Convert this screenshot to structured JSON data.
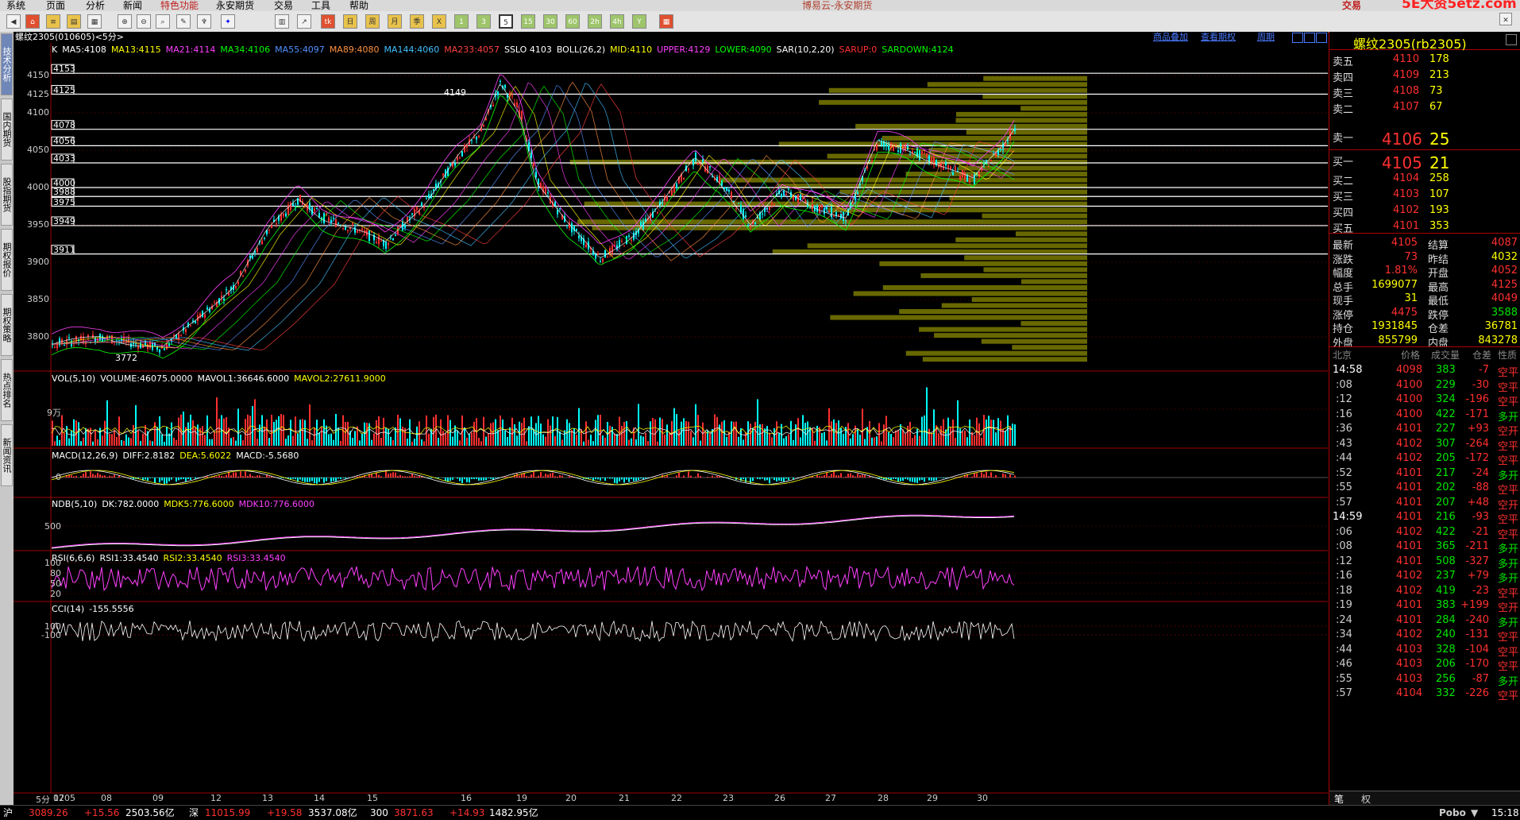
{
  "menu": {
    "items": [
      "系统",
      "页面",
      "分析",
      "新闻",
      "特色功能",
      "永安期货",
      "交易",
      "工具",
      "帮助"
    ],
    "title": "博易云-永安期货",
    "trade": "交易",
    "watermark": "5E大资5etz.com"
  },
  "sidetabs": [
    "技术分析",
    "国内期货",
    "股指期货",
    "期权报价",
    "期权策略",
    "热点排名",
    "新闻资讯"
  ],
  "toolbar": {
    "buttons": [
      "1",
      "3",
      "5",
      "15",
      "30",
      "60",
      "2h",
      "4h",
      "Y"
    ]
  },
  "chart": {
    "contract": "螺纹2305(010605)<5分>",
    "links": [
      "商品叠加",
      "查看期权",
      "周期"
    ],
    "price_ind": [
      {
        "t": "K",
        "c": "#ffffff"
      },
      {
        "t": "MA5:4108",
        "c": "#ffffff"
      },
      {
        "t": "MA13:4115",
        "c": "#ffff00"
      },
      {
        "t": "MA21:4114",
        "c": "#ff40ff"
      },
      {
        "t": "MA34:4106",
        "c": "#00ff00"
      },
      {
        "t": "MA55:4097",
        "c": "#5090ff"
      },
      {
        "t": "MA89:4080",
        "c": "#ff9040"
      },
      {
        "t": "MA144:4060",
        "c": "#40c0ff"
      },
      {
        "t": "MA233:4057",
        "c": "#ff4040"
      },
      {
        "t": "SSLO 4103",
        "c": "#ffffff"
      },
      {
        "t": "BOLL(26,2)",
        "c": "#ffffff"
      },
      {
        "t": "MID:4110",
        "c": "#ffff00"
      },
      {
        "t": "UPPER:4129",
        "c": "#ff40ff"
      },
      {
        "t": "LOWER:4090",
        "c": "#00ff00"
      },
      {
        "t": "SAR(10,2,20)",
        "c": "#ffffff"
      },
      {
        "t": "SARUP:0",
        "c": "#ff3030"
      },
      {
        "t": "SARDOWN:4124",
        "c": "#00ff00"
      }
    ],
    "y_labels": [
      "4150",
      "4125",
      "4100",
      "4050",
      "4000",
      "3950",
      "3900",
      "3850",
      "3800"
    ],
    "y_values": [
      4150,
      4125,
      4100,
      4050,
      4000,
      3950,
      3900,
      3850,
      3800
    ],
    "hlines": [
      4153,
      4125,
      4078,
      4056,
      4033,
      4000,
      3988,
      3975,
      3949,
      3911
    ],
    "hline_labels": [
      "4153",
      "4125",
      "4078",
      "4056",
      "4033",
      "4000",
      "3988",
      "3975",
      "3949",
      "3911"
    ],
    "high_mark": "4149",
    "low_mark": "3772",
    "vol": {
      "title": "VOL(5,10)",
      "v": "VOLUME:46075.0000",
      "m1": "MAVOL1:36646.6000",
      "m2": "MAVOL2:27611.9000",
      "axis": "9万"
    },
    "macd": {
      "title": "MACD(12,26,9)",
      "diff": "DIFF:2.8182",
      "dea": "DEA:5.6022",
      "macd": "MACD:-5.5680",
      "axis": "0"
    },
    "ndb": {
      "title": "NDB(5,10)",
      "dk": "DK:782.0000",
      "m5": "MDK5:776.6000",
      "m10": "MDK10:776.6000",
      "axis": "500"
    },
    "rsi": {
      "title": "RSI(6,6,6)",
      "r1": "RSI1:33.4540",
      "r2": "RSI2:33.4540",
      "r3": "RSI3:33.4540",
      "axis": [
        "100",
        "80",
        "50",
        "20"
      ]
    },
    "cci": {
      "title": "CCI(14)",
      "v": "-155.5556",
      "axis": [
        "100",
        "-100"
      ]
    },
    "x_labels": [
      "5分",
      "1205",
      "07",
      "08",
      "09",
      "12",
      "13",
      "14",
      "15",
      "16",
      "19",
      "20",
      "21",
      "22",
      "23",
      "26",
      "27",
      "28",
      "29",
      "30"
    ]
  },
  "quote": {
    "title": "螺纹2305(rb2305)",
    "asks": [
      {
        "l": "卖五",
        "p": "4110",
        "v": "178"
      },
      {
        "l": "卖四",
        "p": "4109",
        "v": "213"
      },
      {
        "l": "卖三",
        "p": "4108",
        "v": "73"
      },
      {
        "l": "卖二",
        "p": "4107",
        "v": "67"
      },
      {
        "l": "卖一",
        "p": "4106",
        "v": "25"
      }
    ],
    "bids": [
      {
        "l": "买一",
        "p": "4105",
        "v": "21"
      },
      {
        "l": "买二",
        "p": "4104",
        "v": "258"
      },
      {
        "l": "买三",
        "p": "4103",
        "v": "107"
      },
      {
        "l": "买四",
        "p": "4102",
        "v": "193"
      },
      {
        "l": "买五",
        "p": "4101",
        "v": "353"
      }
    ],
    "stats": [
      [
        "最新",
        "4105",
        "结算",
        "4087"
      ],
      [
        "涨跌",
        "73",
        "昨结",
        "4032"
      ],
      [
        "幅度",
        "1.81%",
        "开盘",
        "4052"
      ],
      [
        "总手",
        "1699077",
        "最高",
        "4125"
      ],
      [
        "现手",
        "31",
        "最低",
        "4049"
      ],
      [
        "涨停",
        "4475",
        "跌停",
        "3588"
      ],
      [
        "持仓",
        "1931845",
        "仓差",
        "36781"
      ],
      [
        "外盘",
        "855799",
        "内盘",
        "843278"
      ]
    ],
    "tick_head": [
      "北京",
      "价格",
      "成交量",
      "仓差",
      "性质"
    ],
    "ticks": [
      [
        "14:58",
        "4098",
        "383",
        "-7",
        "空平"
      ],
      [
        ":08",
        "4100",
        "229",
        "-30",
        "空平"
      ],
      [
        ":12",
        "4100",
        "324",
        "-196",
        "空平"
      ],
      [
        ":16",
        "4100",
        "422",
        "-171",
        "多开"
      ],
      [
        ":36",
        "4101",
        "227",
        "+93",
        "空开"
      ],
      [
        ":43",
        "4102",
        "307",
        "-264",
        "空平"
      ],
      [
        ":44",
        "4102",
        "205",
        "-172",
        "空平"
      ],
      [
        ":52",
        "4101",
        "217",
        "-24",
        "多开"
      ],
      [
        ":55",
        "4101",
        "202",
        "-88",
        "空平"
      ],
      [
        ":57",
        "4101",
        "207",
        "+48",
        "空开"
      ],
      [
        "14:59",
        "4101",
        "216",
        "-93",
        "空平"
      ],
      [
        ":06",
        "4102",
        "422",
        "-21",
        "空平"
      ],
      [
        ":08",
        "4101",
        "365",
        "-211",
        "多开"
      ],
      [
        ":12",
        "4101",
        "508",
        "-327",
        "多开"
      ],
      [
        ":16",
        "4102",
        "237",
        "+79",
        "多开"
      ],
      [
        ":18",
        "4102",
        "419",
        "-23",
        "空平"
      ],
      [
        ":19",
        "4101",
        "383",
        "+199",
        "空开"
      ],
      [
        ":24",
        "4101",
        "284",
        "-240",
        "多开"
      ],
      [
        ":34",
        "4102",
        "240",
        "-131",
        "空平"
      ],
      [
        ":44",
        "4103",
        "328",
        "-104",
        "空平"
      ],
      [
        ":46",
        "4103",
        "206",
        "-170",
        "空平"
      ],
      [
        ":55",
        "4103",
        "256",
        "-87",
        "多开"
      ],
      [
        ":57",
        "4104",
        "332",
        "-226",
        "空平"
      ]
    ],
    "tabs": [
      "笔",
      "权"
    ]
  },
  "status": {
    "items": [
      {
        "n": "沪",
        "p": "3089.26",
        "c": "+15.56",
        "a": "2503.56亿"
      },
      {
        "n": "深",
        "p": "11015.99",
        "c": "+19.58",
        "a": "3537.08亿"
      },
      {
        "n": "300",
        "p": "3871.63",
        "c": "+14.93",
        "a": "1482.95亿"
      }
    ],
    "brand": "Pobo",
    "time": "15:18"
  }
}
